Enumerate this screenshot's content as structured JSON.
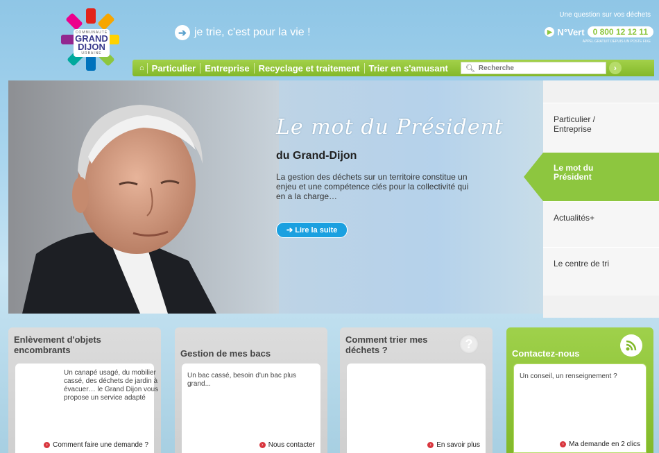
{
  "logo": {
    "line1": "COMMUNAUTÉ",
    "line2": "GRAND",
    "line3": "DIJON",
    "line4": "URBAINE"
  },
  "header": {
    "tagline": "je trie, c'est pour la vie !",
    "question": "Une question sur vos déchets",
    "numvert_label": "N°Vert",
    "numvert_number": "0 800 12 12 11",
    "numvert_sub": "APPEL GRATUIT DEPUIS UN POSTE FIXE"
  },
  "nav": {
    "items": [
      "Particulier",
      "Entreprise",
      "Recyclage et traitement",
      "Trier en s'amusant"
    ],
    "search_placeholder": "Recherche"
  },
  "hero": {
    "title": "Le mot du Président",
    "subtitle": "du Grand-Dijon",
    "body": "La gestion des déchets sur un territoire constitue un enjeu et une compétence clés pour la collectivité qui en a la charge…",
    "button": "➔ Lire la suite"
  },
  "sidemenu": {
    "items": [
      "Particulier / Entreprise",
      "Actualités+",
      "Le centre de tri"
    ],
    "active": "Le mot du Président"
  },
  "cards": [
    {
      "title": "Enlèvement d'objets encombrants",
      "text": "Un canapé usagé, du mobilier cassé, des déchets de jardin à évacuer… le Grand Dijon vous propose un service adapté",
      "link": "Comment faire une demande ?"
    },
    {
      "title": "Gestion de mes bacs",
      "text": "Un bac cassé, besoin d'un bac plus grand...",
      "link": "Nous contacter"
    },
    {
      "title": "Comment trier mes déchets ?",
      "text": "",
      "link": "En savoir plus"
    },
    {
      "title": "Contactez-nous",
      "text": "Un conseil, un renseignement ?",
      "link": "Ma demande en 2 clics"
    }
  ],
  "colors": {
    "green": "#8dc63f",
    "blue_button": "#1aa0e0",
    "red_dot": "#d9363e"
  }
}
